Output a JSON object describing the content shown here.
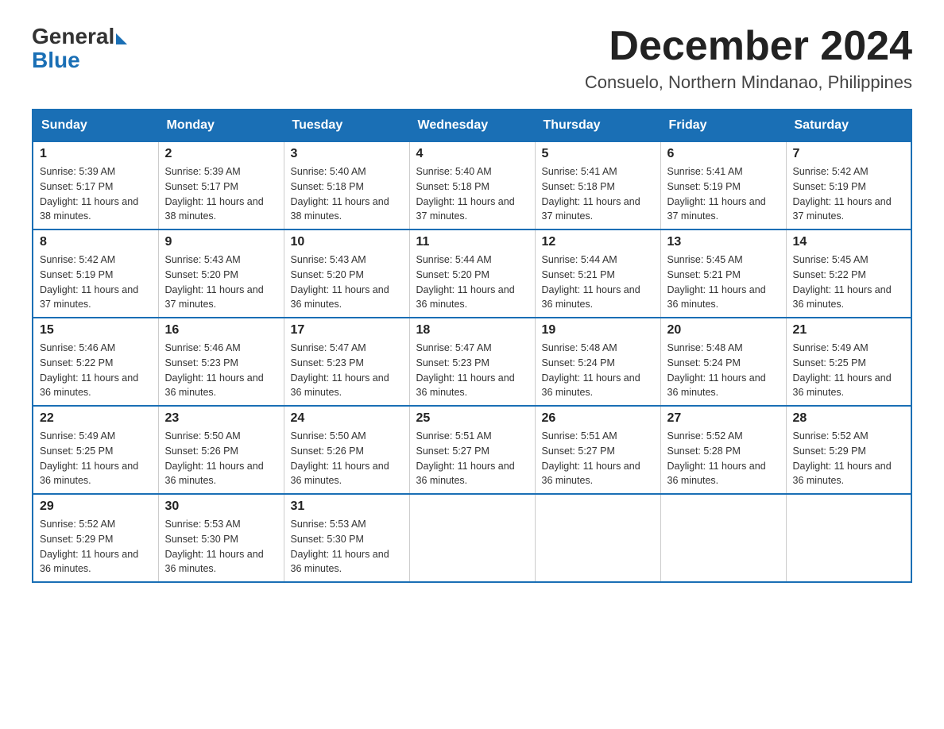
{
  "logo": {
    "general": "General",
    "blue": "Blue"
  },
  "title": "December 2024",
  "subtitle": "Consuelo, Northern Mindanao, Philippines",
  "weekdays": [
    "Sunday",
    "Monday",
    "Tuesday",
    "Wednesday",
    "Thursday",
    "Friday",
    "Saturday"
  ],
  "weeks": [
    [
      {
        "day": "1",
        "sunrise": "Sunrise: 5:39 AM",
        "sunset": "Sunset: 5:17 PM",
        "daylight": "Daylight: 11 hours and 38 minutes."
      },
      {
        "day": "2",
        "sunrise": "Sunrise: 5:39 AM",
        "sunset": "Sunset: 5:17 PM",
        "daylight": "Daylight: 11 hours and 38 minutes."
      },
      {
        "day": "3",
        "sunrise": "Sunrise: 5:40 AM",
        "sunset": "Sunset: 5:18 PM",
        "daylight": "Daylight: 11 hours and 38 minutes."
      },
      {
        "day": "4",
        "sunrise": "Sunrise: 5:40 AM",
        "sunset": "Sunset: 5:18 PM",
        "daylight": "Daylight: 11 hours and 37 minutes."
      },
      {
        "day": "5",
        "sunrise": "Sunrise: 5:41 AM",
        "sunset": "Sunset: 5:18 PM",
        "daylight": "Daylight: 11 hours and 37 minutes."
      },
      {
        "day": "6",
        "sunrise": "Sunrise: 5:41 AM",
        "sunset": "Sunset: 5:19 PM",
        "daylight": "Daylight: 11 hours and 37 minutes."
      },
      {
        "day": "7",
        "sunrise": "Sunrise: 5:42 AM",
        "sunset": "Sunset: 5:19 PM",
        "daylight": "Daylight: 11 hours and 37 minutes."
      }
    ],
    [
      {
        "day": "8",
        "sunrise": "Sunrise: 5:42 AM",
        "sunset": "Sunset: 5:19 PM",
        "daylight": "Daylight: 11 hours and 37 minutes."
      },
      {
        "day": "9",
        "sunrise": "Sunrise: 5:43 AM",
        "sunset": "Sunset: 5:20 PM",
        "daylight": "Daylight: 11 hours and 37 minutes."
      },
      {
        "day": "10",
        "sunrise": "Sunrise: 5:43 AM",
        "sunset": "Sunset: 5:20 PM",
        "daylight": "Daylight: 11 hours and 36 minutes."
      },
      {
        "day": "11",
        "sunrise": "Sunrise: 5:44 AM",
        "sunset": "Sunset: 5:20 PM",
        "daylight": "Daylight: 11 hours and 36 minutes."
      },
      {
        "day": "12",
        "sunrise": "Sunrise: 5:44 AM",
        "sunset": "Sunset: 5:21 PM",
        "daylight": "Daylight: 11 hours and 36 minutes."
      },
      {
        "day": "13",
        "sunrise": "Sunrise: 5:45 AM",
        "sunset": "Sunset: 5:21 PM",
        "daylight": "Daylight: 11 hours and 36 minutes."
      },
      {
        "day": "14",
        "sunrise": "Sunrise: 5:45 AM",
        "sunset": "Sunset: 5:22 PM",
        "daylight": "Daylight: 11 hours and 36 minutes."
      }
    ],
    [
      {
        "day": "15",
        "sunrise": "Sunrise: 5:46 AM",
        "sunset": "Sunset: 5:22 PM",
        "daylight": "Daylight: 11 hours and 36 minutes."
      },
      {
        "day": "16",
        "sunrise": "Sunrise: 5:46 AM",
        "sunset": "Sunset: 5:23 PM",
        "daylight": "Daylight: 11 hours and 36 minutes."
      },
      {
        "day": "17",
        "sunrise": "Sunrise: 5:47 AM",
        "sunset": "Sunset: 5:23 PM",
        "daylight": "Daylight: 11 hours and 36 minutes."
      },
      {
        "day": "18",
        "sunrise": "Sunrise: 5:47 AM",
        "sunset": "Sunset: 5:23 PM",
        "daylight": "Daylight: 11 hours and 36 minutes."
      },
      {
        "day": "19",
        "sunrise": "Sunrise: 5:48 AM",
        "sunset": "Sunset: 5:24 PM",
        "daylight": "Daylight: 11 hours and 36 minutes."
      },
      {
        "day": "20",
        "sunrise": "Sunrise: 5:48 AM",
        "sunset": "Sunset: 5:24 PM",
        "daylight": "Daylight: 11 hours and 36 minutes."
      },
      {
        "day": "21",
        "sunrise": "Sunrise: 5:49 AM",
        "sunset": "Sunset: 5:25 PM",
        "daylight": "Daylight: 11 hours and 36 minutes."
      }
    ],
    [
      {
        "day": "22",
        "sunrise": "Sunrise: 5:49 AM",
        "sunset": "Sunset: 5:25 PM",
        "daylight": "Daylight: 11 hours and 36 minutes."
      },
      {
        "day": "23",
        "sunrise": "Sunrise: 5:50 AM",
        "sunset": "Sunset: 5:26 PM",
        "daylight": "Daylight: 11 hours and 36 minutes."
      },
      {
        "day": "24",
        "sunrise": "Sunrise: 5:50 AM",
        "sunset": "Sunset: 5:26 PM",
        "daylight": "Daylight: 11 hours and 36 minutes."
      },
      {
        "day": "25",
        "sunrise": "Sunrise: 5:51 AM",
        "sunset": "Sunset: 5:27 PM",
        "daylight": "Daylight: 11 hours and 36 minutes."
      },
      {
        "day": "26",
        "sunrise": "Sunrise: 5:51 AM",
        "sunset": "Sunset: 5:27 PM",
        "daylight": "Daylight: 11 hours and 36 minutes."
      },
      {
        "day": "27",
        "sunrise": "Sunrise: 5:52 AM",
        "sunset": "Sunset: 5:28 PM",
        "daylight": "Daylight: 11 hours and 36 minutes."
      },
      {
        "day": "28",
        "sunrise": "Sunrise: 5:52 AM",
        "sunset": "Sunset: 5:29 PM",
        "daylight": "Daylight: 11 hours and 36 minutes."
      }
    ],
    [
      {
        "day": "29",
        "sunrise": "Sunrise: 5:52 AM",
        "sunset": "Sunset: 5:29 PM",
        "daylight": "Daylight: 11 hours and 36 minutes."
      },
      {
        "day": "30",
        "sunrise": "Sunrise: 5:53 AM",
        "sunset": "Sunset: 5:30 PM",
        "daylight": "Daylight: 11 hours and 36 minutes."
      },
      {
        "day": "31",
        "sunrise": "Sunrise: 5:53 AM",
        "sunset": "Sunset: 5:30 PM",
        "daylight": "Daylight: 11 hours and 36 minutes."
      },
      null,
      null,
      null,
      null
    ]
  ]
}
